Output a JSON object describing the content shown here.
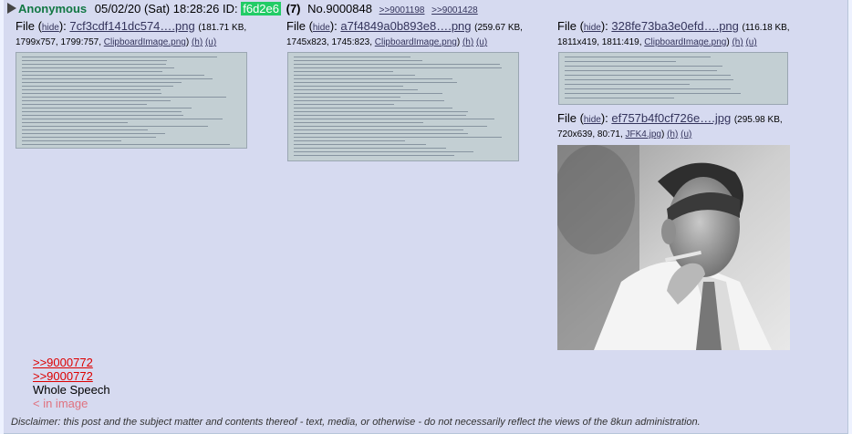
{
  "post": {
    "author": "Anonymous",
    "date": "05/02/20 (Sat) 18:28:26",
    "id_label": "ID:",
    "id_value": "f6d2e6",
    "count": "(7)",
    "number": "No.9000848",
    "backlinks": [
      ">>9001198",
      ">>9001428"
    ]
  },
  "files": [
    {
      "label": "File",
      "hide": "hide",
      "name": "7cf3cdf141dc574….png",
      "meta1": "(181.71 KB,",
      "meta2": "1799x757, 1799:757,",
      "orig": "ClipboardImage.png",
      "h": "(h)",
      "u": "(u)"
    },
    {
      "label": "File",
      "hide": "hide",
      "name": "a7f4849a0b893e8….png",
      "meta1": "(259.67 KB,",
      "meta2": "1745x823, 1745:823,",
      "orig": "ClipboardImage.png",
      "h": "(h)",
      "u": "(u)"
    },
    {
      "label": "File",
      "hide": "hide",
      "name": "328fe73ba3e0efd….png",
      "meta1": "(116.18 KB,",
      "meta2": "1811x419, 1811:419,",
      "orig": "ClipboardImage.png",
      "h": "(h)",
      "u": "(u)"
    },
    {
      "label": "File",
      "hide": "hide",
      "name": "ef757b4f0cf726e….jpg",
      "meta1": "(295.98 KB,",
      "meta2": "720x639, 80:71,",
      "orig": "JFK4.jpg",
      "h": "(h)",
      "u": "(u)"
    }
  ],
  "body": {
    "quotes": [
      ">>9000772",
      ">>9000772"
    ],
    "line": "Whole Speech",
    "inimage": "< in image"
  },
  "disclaimer": "Disclaimer: this post and the subject matter and contents thereof - text, media, or otherwise - do not necessarily reflect the views of the 8kun administration."
}
